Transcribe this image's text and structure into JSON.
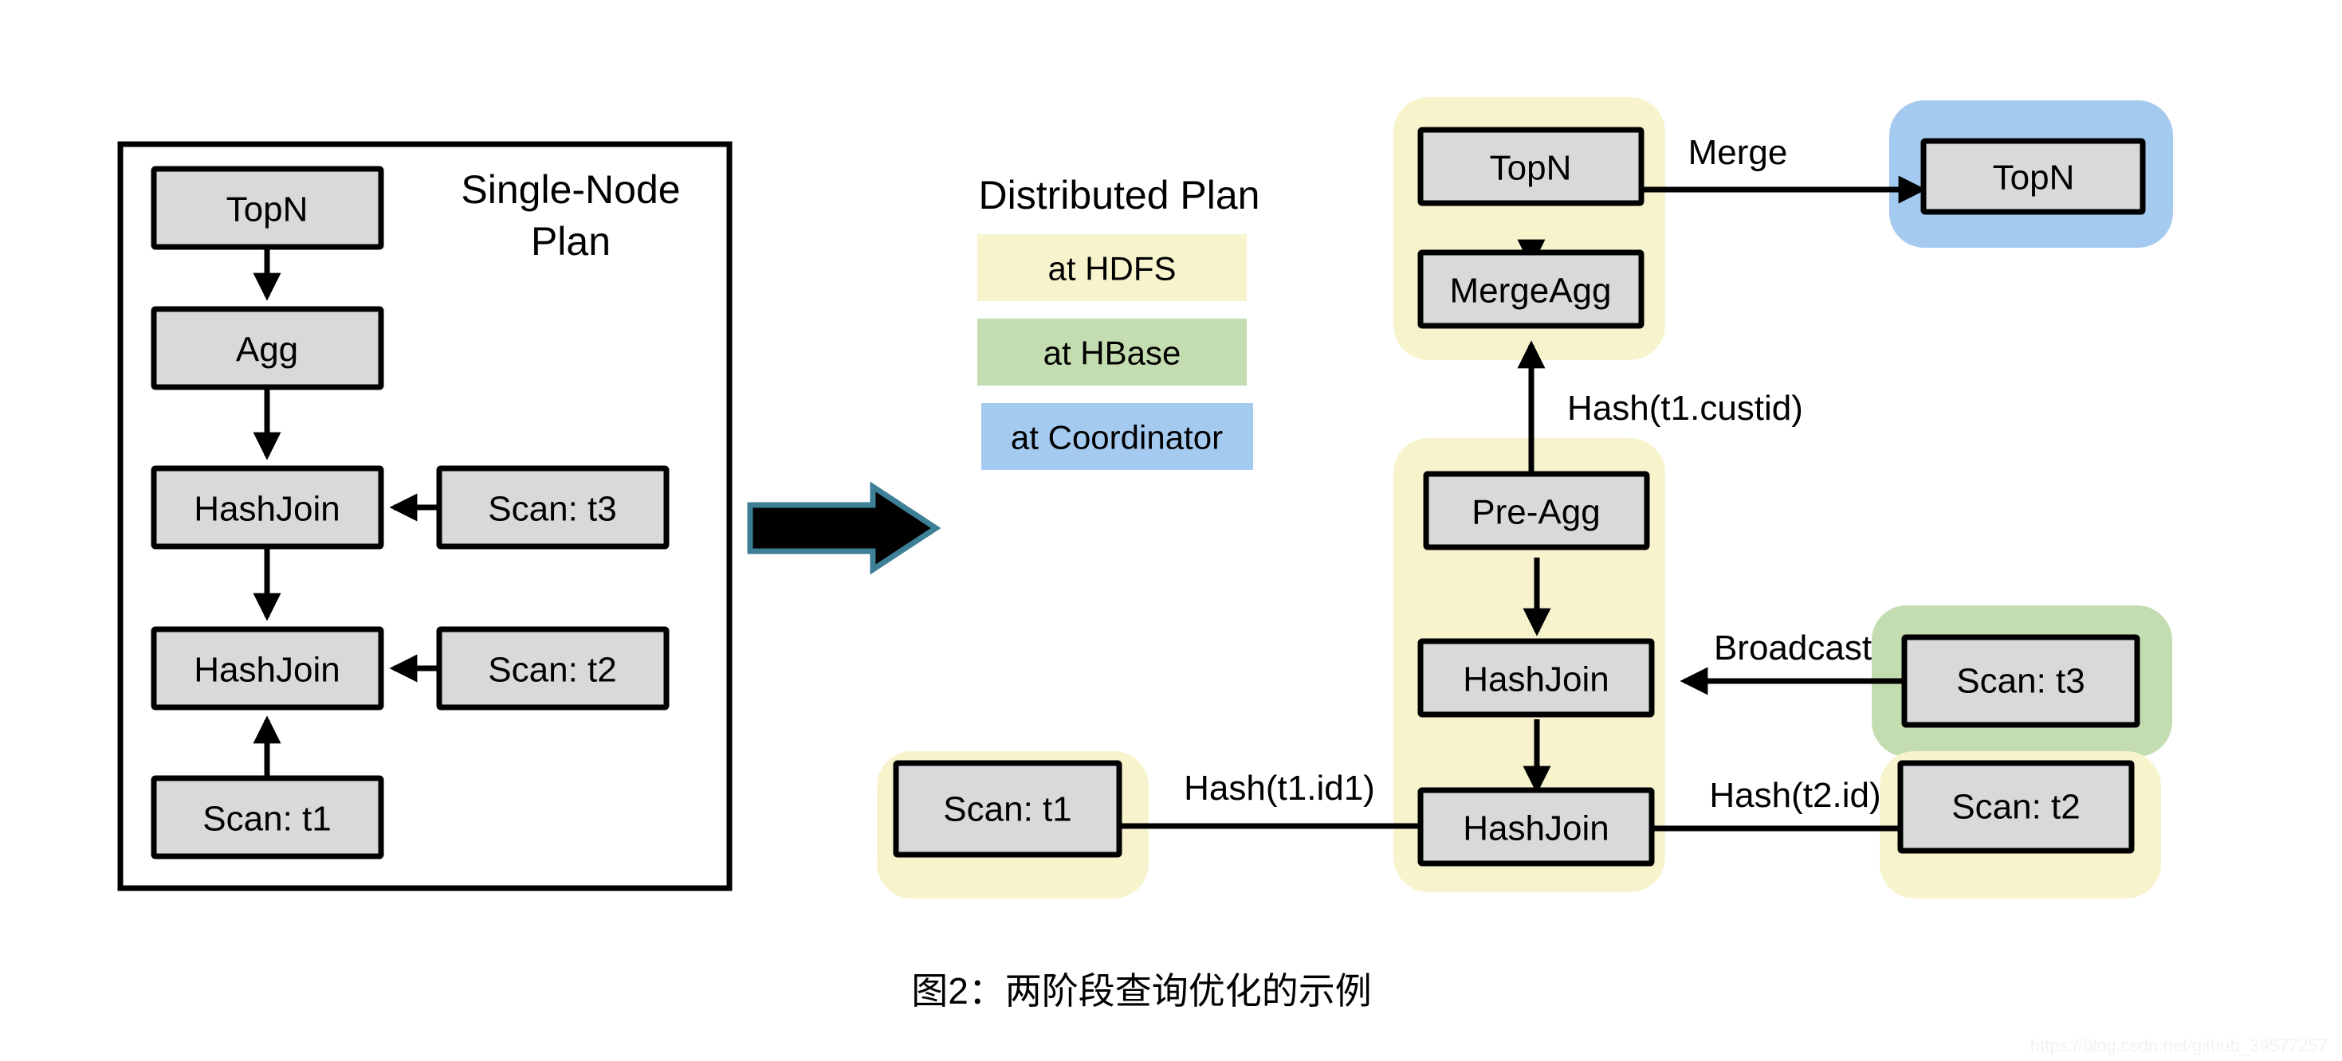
{
  "figure": {
    "caption": "图2：两阶段查询优化的示例",
    "watermark": "https://blog.csdn.net/github_39577257"
  },
  "single_node_plan": {
    "title_line1": "Single-Node",
    "title_line2": "Plan",
    "nodes": [
      {
        "id": "sn-topn",
        "label": "TopN"
      },
      {
        "id": "sn-agg",
        "label": "Agg"
      },
      {
        "id": "sn-hashjoin1",
        "label": "HashJoin"
      },
      {
        "id": "sn-scan-t3",
        "label": "Scan: t3"
      },
      {
        "id": "sn-hashjoin2",
        "label": "HashJoin"
      },
      {
        "id": "sn-scan-t2",
        "label": "Scan: t2"
      },
      {
        "id": "sn-scan-t1",
        "label": "Scan: t1"
      }
    ]
  },
  "transform_arrow": {
    "name": "transform-arrow",
    "fill": "#000000",
    "stroke": "#3d7f96"
  },
  "legend": {
    "title": "Distributed Plan",
    "items": [
      {
        "label": "at HDFS",
        "color": "#f7f4cd"
      },
      {
        "label": "at HBase",
        "color": "#c3ddb0"
      },
      {
        "label": "at Coordinator",
        "color": "#a5caf0"
      }
    ]
  },
  "distributed_plan": {
    "groups": [
      {
        "id": "grp-merge",
        "location": "at HDFS"
      },
      {
        "id": "grp-coord",
        "location": "at Coordinator"
      },
      {
        "id": "grp-join",
        "location": "at HDFS"
      },
      {
        "id": "grp-scan-t3",
        "location": "at HBase"
      },
      {
        "id": "grp-scan-t1",
        "location": "at HDFS"
      },
      {
        "id": "grp-scan-t2",
        "location": "at HDFS"
      }
    ],
    "nodes": [
      {
        "id": "dp-topn",
        "label": "TopN"
      },
      {
        "id": "dp-mergeagg",
        "label": "MergeAgg"
      },
      {
        "id": "dp-coord-topn",
        "label": "TopN"
      },
      {
        "id": "dp-preagg",
        "label": "Pre-Agg"
      },
      {
        "id": "dp-hashjoin-up",
        "label": "HashJoin"
      },
      {
        "id": "dp-hashjoin-lo",
        "label": "HashJoin"
      },
      {
        "id": "dp-scan-t3",
        "label": "Scan: t3"
      },
      {
        "id": "dp-scan-t1",
        "label": "Scan: t1"
      },
      {
        "id": "dp-scan-t2",
        "label": "Scan: t2"
      }
    ],
    "edge_labels": [
      {
        "id": "edge-merge",
        "label": "Merge"
      },
      {
        "id": "edge-hash-custid",
        "label": "Hash(t1.custid)"
      },
      {
        "id": "edge-broadcast",
        "label": "Broadcast"
      },
      {
        "id": "edge-hash-t1id1",
        "label": "Hash(t1.id1)"
      },
      {
        "id": "edge-hash-t2id",
        "label": "Hash(t2.id)"
      }
    ]
  }
}
